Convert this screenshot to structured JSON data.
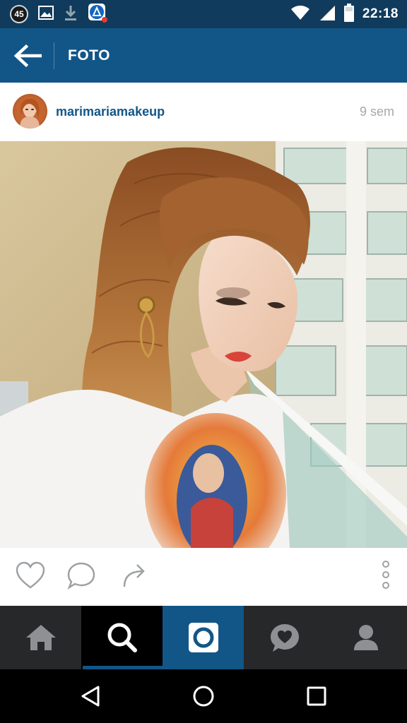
{
  "status_bar": {
    "notification_count": "45",
    "time": "22:18",
    "icons": [
      "notification-count-icon",
      "gallery-icon",
      "download-icon",
      "app-notification-icon",
      "wifi-icon",
      "signal-icon",
      "battery-icon"
    ]
  },
  "header": {
    "title": "FOTO",
    "back_icon": "back-arrow-icon"
  },
  "post": {
    "username": "marimariamakeup",
    "timestamp": "9 sem",
    "avatar_icon": "avatar",
    "photo": "selfie-photo"
  },
  "actions": {
    "icons": [
      "heart-icon",
      "comment-icon",
      "share-icon",
      "more-options-icon"
    ]
  },
  "tabbar": {
    "tabs": [
      "home-icon",
      "search-icon",
      "camera-icon",
      "activity-icon",
      "profile-icon"
    ],
    "active_tab": "search"
  },
  "navbar": {
    "buttons": [
      "back-triangle-icon",
      "home-circle-icon",
      "recents-square-icon"
    ]
  },
  "colors": {
    "status_bar": "#103b5c",
    "app_bar": "#125688",
    "username": "#125688",
    "timestamp": "#a5a7aa",
    "tab_bar": "#26282a",
    "tab_active": "#000000",
    "tab_camera": "#125688"
  }
}
